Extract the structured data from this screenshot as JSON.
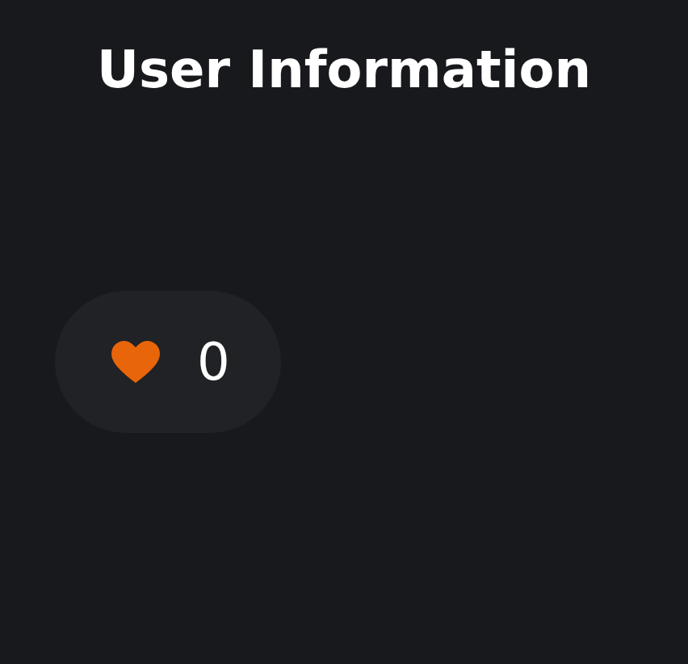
{
  "title": "User Information",
  "like_button": {
    "count": "0"
  }
}
